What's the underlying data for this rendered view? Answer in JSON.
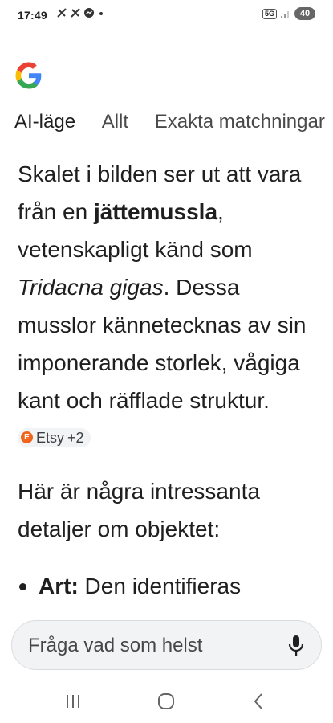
{
  "status_bar": {
    "time": "17:49",
    "notification_icons": [
      "crossed-tools-icon",
      "crossed-tools-icon",
      "messenger-icon",
      "dot-icon"
    ],
    "network": "5G",
    "battery": "40"
  },
  "tabs": [
    {
      "label": "AI-läge",
      "active": true
    },
    {
      "label": "Allt",
      "active": false
    },
    {
      "label": "Exakta matchningar",
      "active": false
    }
  ],
  "answer": {
    "p1_a": "Skalet i bilden ser ut att vara från en ",
    "p1_bold": "jättemussla",
    "p1_b": ", vetenskapligt känd som ",
    "p1_italic": "Tridacna gigas",
    "p1_c": ". Dessa musslor kännetecknas av sin imponerande storlek, vågiga kant och räfflade struktur. ",
    "source_chip": {
      "label": "Etsy",
      "more": "+2",
      "icon_letter": "E"
    },
    "p2": "Här är några intressanta detaljer om objektet:",
    "bullet1_bold": "Art:",
    "bullet1_text": " Den identifieras"
  },
  "search": {
    "placeholder": "Fråga vad som helst"
  },
  "colors": {
    "google_blue": "#4285F4",
    "google_red": "#EA4335",
    "google_yellow": "#FBBC05",
    "google_green": "#34A853",
    "etsy_orange": "#F1641E"
  }
}
